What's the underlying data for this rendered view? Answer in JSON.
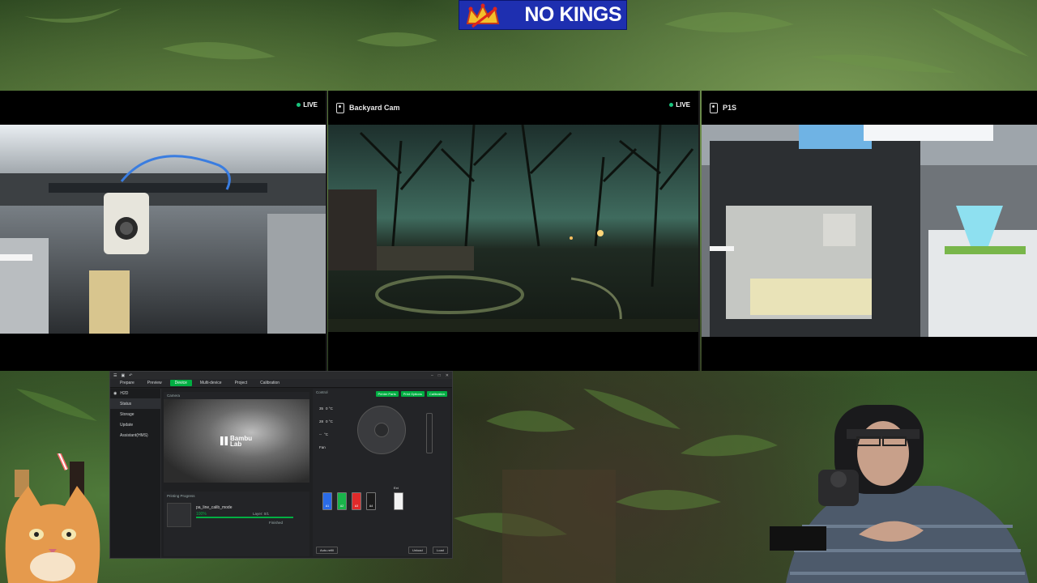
{
  "banner": {
    "text": "NO KINGS"
  },
  "cameras": [
    {
      "title": "",
      "live": "LIVE"
    },
    {
      "title": "Backyard Cam",
      "live": "LIVE"
    },
    {
      "title": "P1S",
      "live": ""
    }
  ],
  "studio": {
    "nav_tabs": [
      "Prepare",
      "Preview",
      "Device",
      "Multi-device",
      "Project",
      "Calibration"
    ],
    "active_tab": "Device",
    "printer_name": "H2D",
    "sidebar_items": [
      "Status",
      "Storage",
      "Update",
      "Assistant(HMS)"
    ],
    "camera_label": "Camera",
    "brand": "Bambu Lab",
    "progress_label": "Printing Progress",
    "job_name": "pa_line_calib_mode",
    "percent": "100%",
    "percent_value": 1.0,
    "layer": "Layer: 0/1",
    "status": "Finished",
    "control_label": "Control",
    "control_buttons": [
      "Printer Parts",
      "Print Options",
      "Calibration"
    ],
    "temps": [
      {
        "value": "35",
        "target": "0 °C"
      },
      {
        "value": "28",
        "target": "0 °C"
      },
      {
        "value": "--",
        "target": "°C"
      }
    ],
    "fan_label": "Fan",
    "extrusion_label": "Ext",
    "bottom_buttons": [
      "Auto-refill",
      "Unload",
      "Load"
    ]
  },
  "colors": {
    "accent": "#00ae42",
    "banner": "#1e2fb0",
    "filament_1": "#2a6be8",
    "filament_2": "#19b34a",
    "filament_3": "#e02a2a",
    "filament_4": "#1a1a1a"
  },
  "icons": [
    "camera-icon",
    "live-dot-icon",
    "crown-icon",
    "joystick-icon"
  ]
}
